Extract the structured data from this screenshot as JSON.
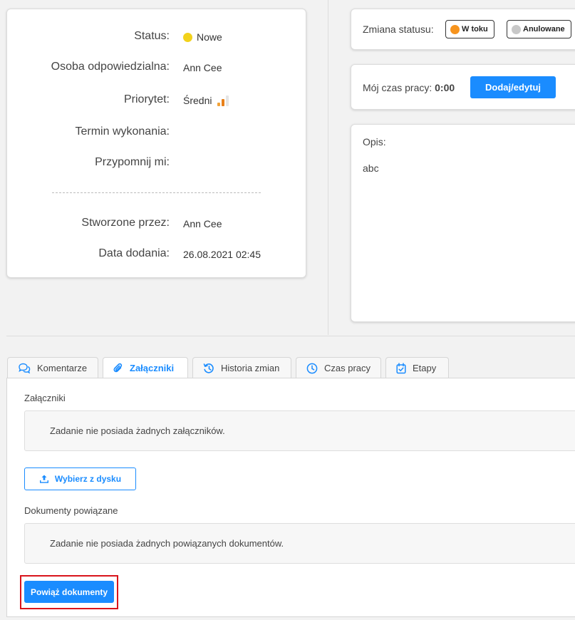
{
  "info": {
    "status_label": "Status:",
    "status_value": "Nowe",
    "status_color": "#f2d21b",
    "responsible_label": "Osoba odpowiedzialna:",
    "responsible_value": "Ann Cee",
    "priority_label": "Priorytet:",
    "priority_value": "Średni",
    "priority_colors": [
      "#f2a33a",
      "#e8801a",
      "#e5e5e5"
    ],
    "deadline_label": "Termin wykonania:",
    "deadline_value": "",
    "reminder_label": "Przypomnij mi:",
    "reminder_value": "",
    "created_by_label": "Stworzone przez:",
    "created_by_value": "Ann Cee",
    "date_added_label": "Data dodania:",
    "date_added_value": "26.08.2021 02:45"
  },
  "status_change": {
    "label": "Zmiana statusu:",
    "buttons": [
      {
        "label": "W toku",
        "color": "#f7941d"
      },
      {
        "label": "Anulowane",
        "color": "#c8c8c8"
      }
    ]
  },
  "work_time": {
    "label": "Mój czas pracy:",
    "value": "0:00",
    "button": "Dodaj/edytuj"
  },
  "description": {
    "label": "Opis:",
    "text": "abc"
  },
  "tabs": [
    {
      "label": "Komentarze",
      "icon": "comments-icon",
      "active": false
    },
    {
      "label": "Załączniki",
      "icon": "paperclip-icon",
      "active": true
    },
    {
      "label": "Historia zmian",
      "icon": "history-icon",
      "active": false
    },
    {
      "label": "Czas pracy",
      "icon": "clock-icon",
      "active": false
    },
    {
      "label": "Etapy",
      "icon": "calendar-check-icon",
      "active": false
    }
  ],
  "attachments": {
    "title": "Załączniki",
    "empty_text": "Zadanie nie posiada żadnych załączników.",
    "upload_button": "Wybierz z dysku"
  },
  "related_docs": {
    "title": "Dokumenty powiązane",
    "empty_text": "Zadanie nie posiada żadnych powiązanych dokumentów.",
    "link_button": "Powiąż dokumenty"
  },
  "colors": {
    "accent": "#1a8cff",
    "highlight": "#d9141b"
  }
}
